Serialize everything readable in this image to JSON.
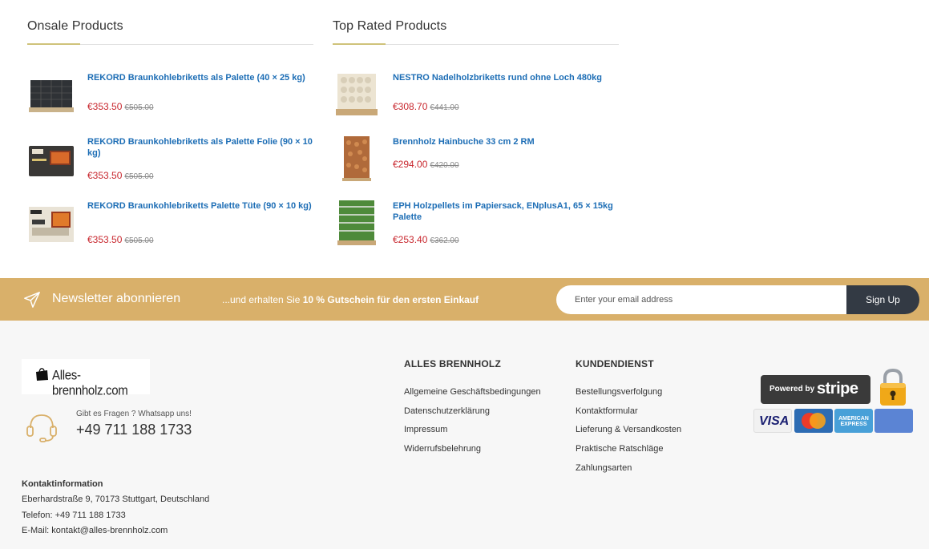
{
  "onsale": {
    "title": "Onsale Products",
    "items": [
      {
        "name": "REKORD Braunkohlebriketts als Palette (40 × 25 kg)",
        "price": "€353.50",
        "old_price": "€505.00"
      },
      {
        "name": "REKORD Braunkohlebriketts als Palette Folie (90 × 10 kg)",
        "price": "€353.50",
        "old_price": "€505.00"
      },
      {
        "name": "REKORD Braunkohlebriketts Palette Tüte (90 × 10 kg)",
        "price": "€353.50",
        "old_price": "€505.00"
      }
    ]
  },
  "toprated": {
    "title": "Top Rated Products",
    "items": [
      {
        "name": "NESTRO Nadelholzbriketts rund ohne Loch 480kg",
        "price": "€308.70",
        "old_price": "€441.00"
      },
      {
        "name": "Brennholz Hainbuche 33 cm 2 RM",
        "price": "€294.00",
        "old_price": "€420.00"
      },
      {
        "name": "EPH Holzpellets im Papiersack, ENplusA1, 65 × 15kg Palette",
        "price": "€253.40",
        "old_price": "€362.00"
      }
    ]
  },
  "newsletter": {
    "title": "Newsletter abonnieren",
    "sub_prefix": "...und erhalten Sie ",
    "sub_bold": "10 % Gutschein für den ersten Einkauf",
    "placeholder": "Enter your email address",
    "button": "Sign Up",
    "bar_color": "#d9b06a"
  },
  "footer": {
    "logo_text": "Alles-brennholz.com",
    "support_question": "Gibt es Fragen ? Whatsapp uns!",
    "support_phone": "+49 711 188 1733",
    "contact_head": "Kontaktinformation",
    "contact_address": "Eberhardstraße 9, 70173 Stuttgart, Deutschland",
    "contact_phone": "Telefon: +49 711 188 1733",
    "contact_email": "E-Mail: kontakt@alles-brennholz.com",
    "col1": {
      "title": "ALLES BRENNHOLZ",
      "links": [
        "Allgemeine Geschäftsbedingungen",
        "Datenschutzerklärung",
        "Impressum",
        "Widerrufsbelehrung"
      ]
    },
    "col2": {
      "title": "KUNDENDIENST",
      "links": [
        "Bestellungsverfolgung",
        "Kontaktformular",
        "Lieferung & Versandkosten",
        "Praktische Ratschläge",
        "Zahlungsarten"
      ]
    },
    "payments": {
      "powered_by": "Powered by",
      "stripe": "stripe",
      "visa": "VISA",
      "amex": "AMERICAN EXPRESS"
    }
  }
}
